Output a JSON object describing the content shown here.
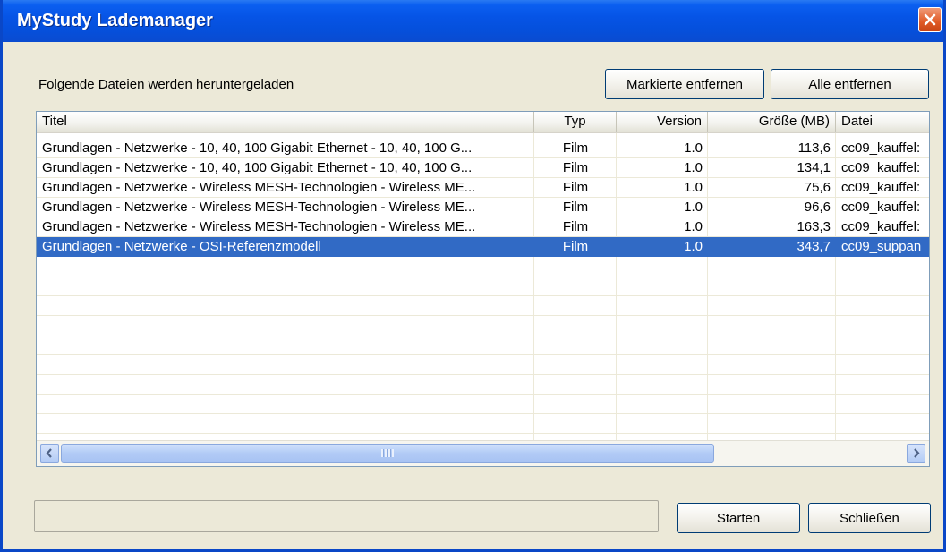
{
  "window": {
    "title": "MyStudy Lademanager"
  },
  "heading": "Folgende Dateien werden heruntergeladen",
  "buttons": {
    "remove_marked": "Markierte entfernen",
    "remove_all": "Alle entfernen",
    "start": "Starten",
    "close": "Schließen"
  },
  "table": {
    "columns": [
      "Titel",
      "Typ",
      "Version",
      "Größe (MB)",
      "Datei"
    ],
    "rows": [
      {
        "title": "Grundlagen - Netzwerke - 10, 40, 100 Gigabit Ethernet - 10, 40, 100 G...",
        "type": "Film",
        "version": "1.0",
        "size": "113,6",
        "file": "cc09_kauffel:"
      },
      {
        "title": "Grundlagen - Netzwerke - 10, 40, 100 Gigabit Ethernet - 10, 40, 100 G...",
        "type": "Film",
        "version": "1.0",
        "size": "134,1",
        "file": "cc09_kauffel:"
      },
      {
        "title": "Grundlagen - Netzwerke - Wireless MESH-Technologien - Wireless ME...",
        "type": "Film",
        "version": "1.0",
        "size": "75,6",
        "file": "cc09_kauffel:"
      },
      {
        "title": "Grundlagen - Netzwerke - Wireless MESH-Technologien - Wireless ME...",
        "type": "Film",
        "version": "1.0",
        "size": "96,6",
        "file": "cc09_kauffel:"
      },
      {
        "title": "Grundlagen - Netzwerke - Wireless MESH-Technologien - Wireless ME...",
        "type": "Film",
        "version": "1.0",
        "size": "163,3",
        "file": "cc09_kauffel:"
      },
      {
        "title": "Grundlagen - Netzwerke - OSI-Referenzmodell",
        "type": "Film",
        "version": "1.0",
        "size": "343,7",
        "file": "cc09_suppan",
        "selected": true
      }
    ]
  },
  "status": {
    "text": ""
  },
  "colors": {
    "titlebar": "#0054e3",
    "selection": "#316ac5",
    "close_button": "#e05a26",
    "window_face": "#ece9d8"
  },
  "icons": {
    "close": "close-x-icon",
    "scroll_left": "arrow-left-icon",
    "scroll_right": "arrow-right-icon",
    "grip": "scroll-grip-icon"
  }
}
